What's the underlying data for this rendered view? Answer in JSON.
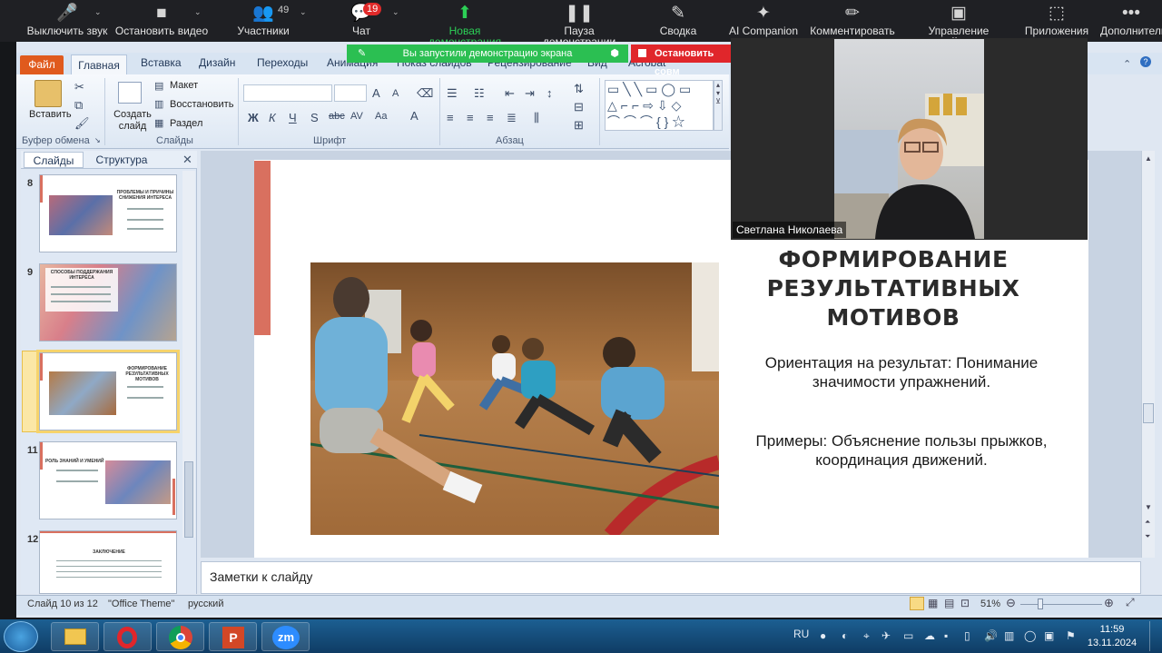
{
  "zoom_toolbar": {
    "mute_label": "Выключить звук",
    "video_label": "Остановить видео",
    "participants_label": "Участники",
    "participants_count": "49",
    "chat_label": "Чат",
    "chat_badge": "19",
    "new_share_label": "Новая демонстрация",
    "pause_share_label": "Пауза демонстрации",
    "summary_label": "Сводка",
    "ai_label": "AI Companion",
    "annotate_label": "Комментировать",
    "remote_label": "Управление слайдами",
    "apps_label": "Приложения",
    "more_label": "Дополнительно"
  },
  "share_banner": {
    "text": "Вы запустили демонстрацию экрана",
    "stop_label": "Остановить совм"
  },
  "ribbon": {
    "file_tab": "Файл",
    "tabs": [
      "Главная",
      "Вставка",
      "Дизайн",
      "Переходы",
      "Анимация",
      "Показ слайдов",
      "Рецензирование",
      "Вид",
      "Acrobat"
    ],
    "paste_label": "Вставить",
    "new_slide_label": "Создать слайд",
    "layout_label": "Макет",
    "reset_label": "Восстановить",
    "section_label": "Раздел",
    "groups": [
      "Буфер обмена",
      "Слайды",
      "Шрифт",
      "Абзац"
    ]
  },
  "slide_panel": {
    "tab_slides": "Слайды",
    "tab_outline": "Структура",
    "slides": [
      {
        "num": "8",
        "title": "ПРОБЛЕМЫ И ПРИЧИНЫ СНИЖЕНИЯ ИНТЕРЕСА"
      },
      {
        "num": "9",
        "title": "СПОСОБЫ ПОДДЕРЖАНИЯ ИНТЕРЕСА"
      },
      {
        "num": "10",
        "title": "ФОРМИРОВАНИЕ РЕЗУЛЬТАТИВНЫХ МОТИВОВ"
      },
      {
        "num": "11",
        "title": "РОЛЬ ЗНАНИЙ И УМЕНИЙ"
      },
      {
        "num": "12",
        "title": "ЗАКЛЮЧЕНИЕ"
      }
    ]
  },
  "slide": {
    "title": "ФОРМИРОВАНИЕ РЕЗУЛЬТАТИВНЫХ МОТИВОВ",
    "body1": "Ориентация на результат: Понимание значимости упражнений.",
    "body2": "Примеры: Объяснение пользы прыжков, координация движений."
  },
  "notes_placeholder": "Заметки к слайду",
  "status": {
    "slide_counter": "Слайд 10 из 12",
    "theme": "\"Office Theme\"",
    "language": "русский",
    "zoom": "51%"
  },
  "video": {
    "speaker_name": "Светлана Николаева"
  },
  "taskbar": {
    "lang": "RU",
    "time": "11:59",
    "date": "13.11.2024"
  },
  "colors": {
    "accent_bar": "#d9705f",
    "share_green": "#2bbf52",
    "stop_red": "#e0262b",
    "file_tab": "#e05a1d"
  }
}
